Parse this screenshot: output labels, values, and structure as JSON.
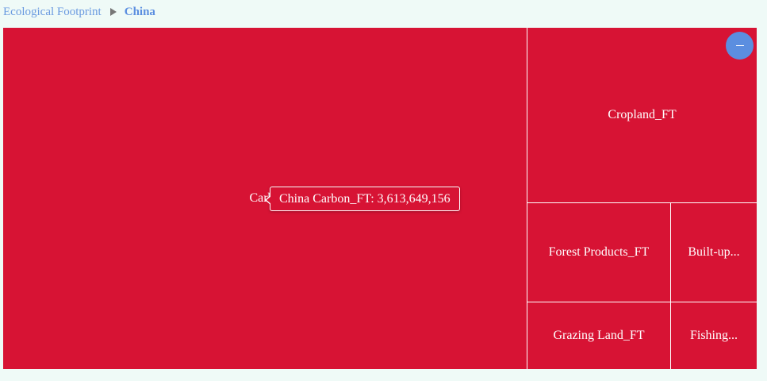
{
  "breadcrumb": {
    "root": "Ecological Footprint",
    "current": "China"
  },
  "chart_data": {
    "type": "treemap",
    "color": "#d71334",
    "tiles": [
      {
        "label": "Carbon_FT",
        "display": "Carbo",
        "value": 3613649156
      },
      {
        "label": "Cropland_FT",
        "display": "Cropland_FT"
      },
      {
        "label": "Forest Products_FT",
        "display": "Forest Products_FT"
      },
      {
        "label": "Built-up",
        "display": "Built-up..."
      },
      {
        "label": "Grazing Land_FT",
        "display": "Grazing Land_FT"
      },
      {
        "label": "Fishing",
        "display": "Fishing..."
      }
    ]
  },
  "tooltip": {
    "text": "China Carbon_FT: 3,613,649,156"
  },
  "zoom_button": {
    "icon": "minus-icon",
    "color": "#5b8ee0"
  }
}
